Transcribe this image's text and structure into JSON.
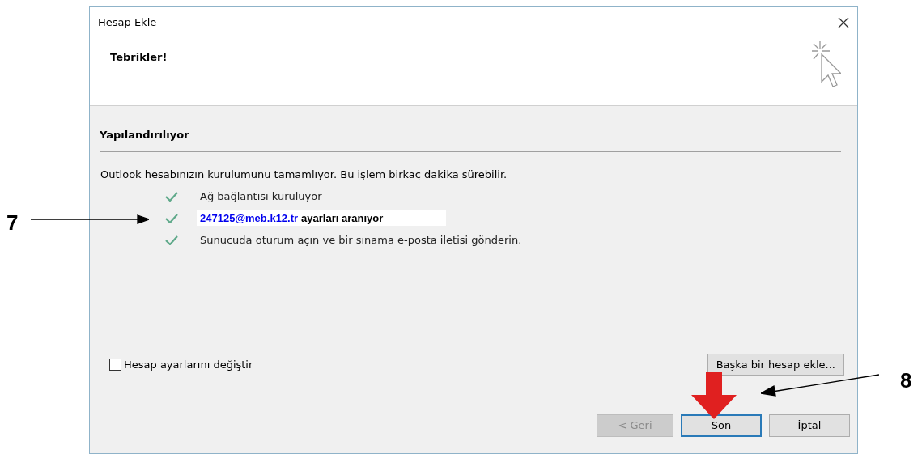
{
  "window": {
    "title": "Hesap Ekle"
  },
  "header": {
    "title": "Tebrikler!"
  },
  "section": {
    "title": "Yapılandırılıyor",
    "intro": "Outlook hesabınızın kurulumunu tamamlıyor. Bu işlem birkaç dakika sürebilir.",
    "steps": [
      {
        "kind": "plain",
        "checked": true,
        "text": "Ağ bağlantısı kuruluyor"
      },
      {
        "kind": "annotated",
        "checked": true,
        "link": "247125@meb.k12.tr",
        "text": "ayarları aranıyor"
      },
      {
        "kind": "plain",
        "checked": true,
        "text": "Sunucuda oturum açın ve bir sınama e-posta iletisi gönderin."
      }
    ]
  },
  "change_settings": {
    "label": "Hesap ayarlarını değiştir",
    "checked": false
  },
  "add_another": {
    "label": "Başka bir hesap ekle..."
  },
  "buttons": [
    {
      "label": "< Geri",
      "disabled": true,
      "selected": false
    },
    {
      "label": "Son",
      "disabled": false,
      "selected": true
    },
    {
      "label": "İptal",
      "disabled": false,
      "selected": false
    }
  ],
  "annotations": [
    {
      "label": "7"
    },
    {
      "label": "8"
    }
  ]
}
